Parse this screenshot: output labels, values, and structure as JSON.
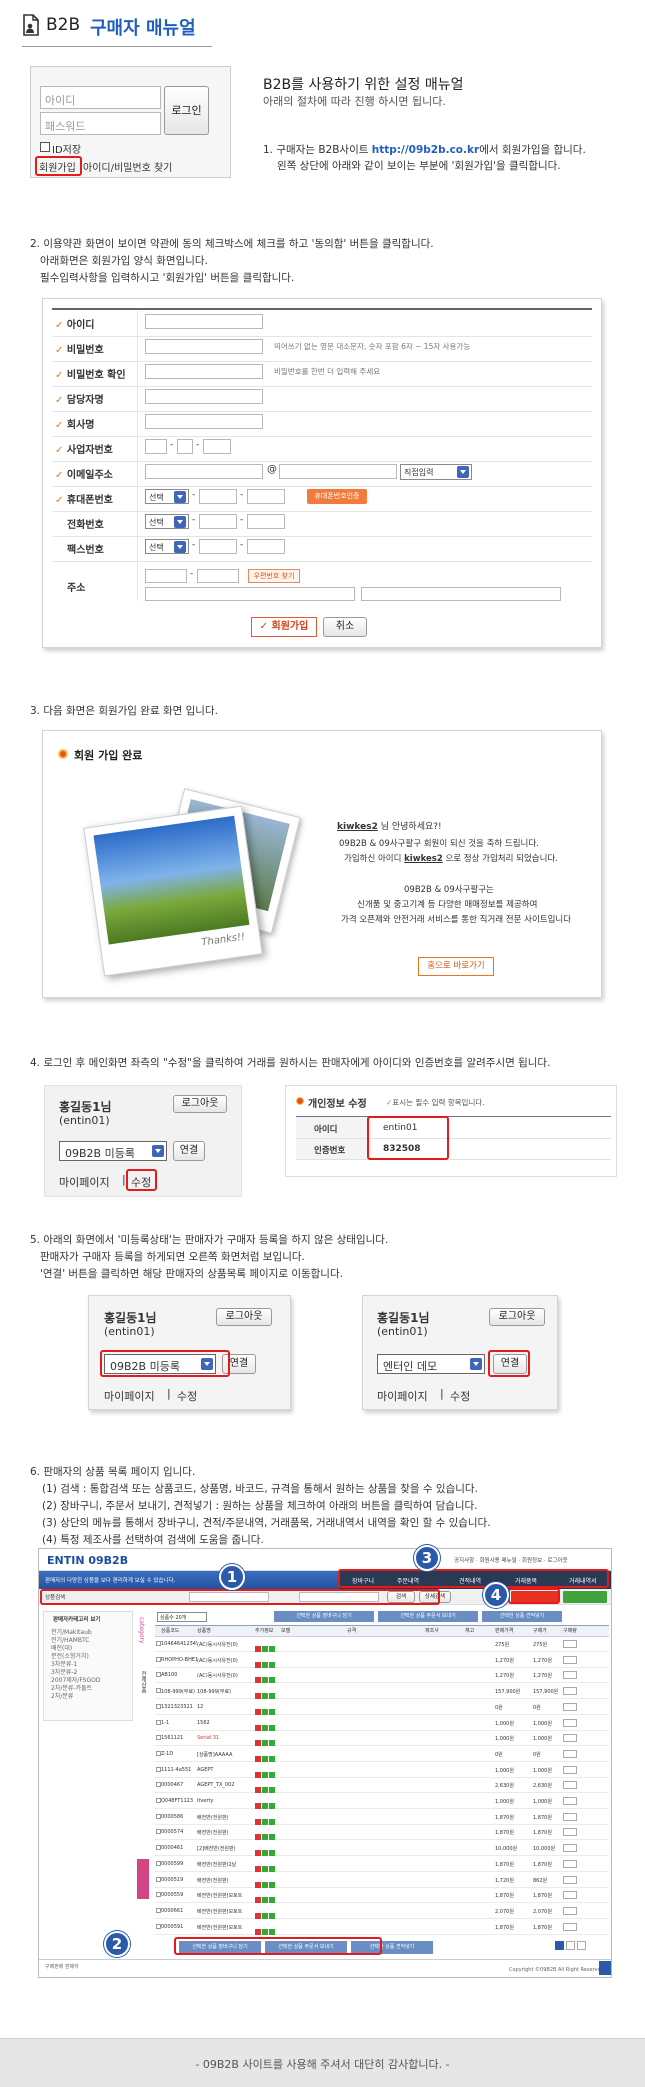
{
  "header": {
    "title_prefix": "B2B",
    "title_main": "구매자 매뉴얼"
  },
  "login_widget": {
    "id_placeholder": "아이디",
    "pw_placeholder": "패스워드",
    "login_btn": "로그인",
    "save_id": "ID저장",
    "join_link": "회원가입",
    "find_link": "아이디/비밀번호 찾기"
  },
  "intro": {
    "title": "B2B를 사용하기 위한 설정 매뉴얼",
    "subtitle": "아래의 절차에 따라 진행 하시면 됩니다.",
    "step1_a": "1. 구매자는 B2B사이트 ",
    "step1_link": "http://09b2b.co.kr",
    "step1_b": "에서 회원가입을 합니다.",
    "step1_c": "왼쪽 상단에 아래와 같이 보이는 부분에 '회원가입'을 클릭합니다."
  },
  "step2": {
    "line1": "2. 이용약관 화면이 보이면 약관에 동의 체크박스에 체크를 하고 '동의함' 버튼을 클릭합니다.",
    "line2": "아래화면은 회원가입 양식 화면입니다.",
    "line3": "필수입력사항을 입력하시고 '회원가입' 버튼을 클릭합니다."
  },
  "signup_form": {
    "labels": [
      "아이디",
      "비밀번호",
      "비밀번호 확인",
      "담당자명",
      "회사명",
      "사업자번호",
      "이메일주소",
      "휴대폰번호",
      "전화번호",
      "팩스번호",
      "주소"
    ],
    "pw_hint": "띄어쓰기 없는 영문 대소문자, 숫자 포함 6자 ~ 15자 사용가능",
    "pw_confirm_hint": "비밀번호를 한번 더 입력해 주세요",
    "email_at": "@",
    "email_select": "직접입력",
    "select_label": "선택",
    "phone_verify_btn": "휴대폰번호인증",
    "zip_btn": "우편번호 찾기",
    "submit_btn": "회원가입",
    "cancel_btn": "취소"
  },
  "step3": {
    "line1": "3. 다음 화면은 회원가입 완료 화면 입니다."
  },
  "complete": {
    "title": "회원 가입 완료",
    "user": "kiwkes2",
    "greet": " 님 안녕하세요?!",
    "msg1": "09B2B & 09사구팔구 회원이 되신 것을 축하 드립니다.",
    "msg2a": "가입하신 아이디 ",
    "msg2b": " 으로 정상 가입처리 되었습니다.",
    "msg3": "09B2B & 09사구팔구는",
    "msg4": "신개품 및 중고기계 등 다양한 매매정보를 제공하여",
    "msg5": "가격 오픈제와 안전거래 서비스를 통한 직거래 전문 사이트입니다",
    "home_btn": "홈으로 바로가기",
    "photo_caption": "Thanks!!"
  },
  "step4": {
    "line1": "4. 로그인 후 메인화면 좌측의 \"수정\"을 클릭하여 거래를 원하시는 판매자에게 아이디와 인증번호를 알려주시면 됩니다."
  },
  "user_widget": {
    "name": "홍길동1님",
    "id": "(entin01)",
    "logout": "로그아웃",
    "seller_unreg": "09B2B 미등록",
    "seller_demo": "엔터인 데모",
    "connect": "연결",
    "mypage": "마이페이지",
    "edit": "수정"
  },
  "profile": {
    "title": "개인정보 수정",
    "required": "표시는 필수 입력 항목입니다.",
    "id_label": "아이디",
    "id_value": "entin01",
    "cert_label": "인증번호",
    "cert_value": "832508"
  },
  "step5": {
    "line1": "5. 아래의 화면에서 '미등록상태'는 판매자가 구매자 등록을 하지 않은 상태입니다.",
    "line2": "판매자가 구매자 등록을 하게되면 오른쪽 화면처럼 보입니다.",
    "line3": "'연결' 버튼을 클릭하면 해당 판매자의 상품목록 페이지로 이동합니다."
  },
  "step6": {
    "line1": "6. 판매자의 상품 목록 페이지 입니다.",
    "line2": "(1) 검색 : 통합검색 또는 상품코드, 상품명, 바코드, 규격을 통해서 원하는 상품을 찾을 수 있습니다.",
    "line3": "(2) 장바구니, 주문서 보내기, 견적넣기 : 원하는 상품을 체크하여 아래의 버튼을 클릭하여 담습니다.",
    "line4": "(3) 상단의 메뉴를 통해서 장바구니, 견적/주문내역, 거래품목, 거래내역서 내역을 확인 할 수 있습니다.",
    "line5": "(4) 특정 제조사를 선택하여 검색에 도움을 줍니다."
  },
  "shop": {
    "logo": "ENTIN 09B2B",
    "top_links": [
      "공지사항",
      "회원사용 매뉴얼",
      "회원정보",
      "로그아웃"
    ],
    "menu": [
      "장바구니",
      "주문내역",
      "견적내역",
      "거래품목",
      "거래내역서"
    ],
    "welcome": "판매자의 다양한 상품을 보다 편리하게 보실 수 있습니다.",
    "search_label": "상품검색",
    "search_btn": "검색",
    "detail_btn": "상세검색",
    "category_title": "판매자카테고리 보기",
    "categories": [
      "전기/Makitaub",
      "전기/HAMBTC",
      "배전(대)",
      "분전(소형거치)",
      "3차분류-1",
      "3차분류-2",
      "2007제자/FSGOD",
      "2차/분류-카돌트",
      "2차/분류"
    ],
    "vertical_cat": "category",
    "vertical_lbl": "전체상품",
    "per_page": "상품수 20개",
    "col_headers": [
      "상품코드",
      "상품명",
      "추가정보",
      "모델",
      "규격",
      "제조사",
      "재고",
      "판매가격",
      "구매가",
      "구매량"
    ],
    "actions_top": [
      "선택한 상품 장바구니 담기",
      "선택한 상품 주문서 보내기",
      "선택한 상품 견적넣기"
    ],
    "rows": [
      [
        "10464641234567890",
        "(AC)동시사유전(0)",
        "",
        "",
        "",
        "",
        "",
        "275원",
        "275원",
        ""
      ],
      [
        "RHOPHO-BHE12",
        "(AC)동시사유전(0)",
        "",
        "",
        "",
        "",
        "",
        "1,270원",
        "1,270원",
        ""
      ],
      [
        "AB100",
        "(AC)동시사유전(0)",
        "",
        "",
        "",
        "",
        "",
        "1,270원",
        "1,270원",
        ""
      ],
      [
        "108-999(무료)",
        "108-999(무료)",
        "",
        "",
        "",
        "",
        "",
        "157,900원",
        "157,900원",
        ""
      ],
      [
        "1321323321",
        "12",
        "",
        "",
        "",
        "",
        "",
        "0원",
        "0원",
        ""
      ],
      [
        "1-1",
        "1562",
        "",
        "",
        "",
        "",
        "",
        "1,000원",
        "1,000원",
        ""
      ],
      [
        "1561121",
        "Serial 31",
        "",
        "",
        "",
        "",
        "",
        "1,000원",
        "1,000원",
        ""
      ],
      [
        "Z-1D",
        "[상품명]AAAAA",
        "",
        "",
        "",
        "",
        "",
        "0원",
        "0원",
        ""
      ],
      [
        "1111-4a551",
        "AGEPT",
        "",
        "",
        "",
        "",
        "",
        "1,000원",
        "1,000원",
        ""
      ],
      [
        "0000467",
        "AGEPT_TX_002",
        "",
        "",
        "",
        "",
        "",
        "2,630원",
        "2,630원",
        ""
      ],
      [
        "Q048FT1123",
        "Itverty",
        "",
        "",
        "",
        "",
        "",
        "1,000원",
        "1,000원",
        ""
      ],
      [
        "0000586",
        "배전반(전원판)",
        "",
        "",
        "",
        "",
        "",
        "1,870원",
        "1,870원",
        ""
      ],
      [
        "0000574",
        "배전반(전원판)",
        "",
        "",
        "",
        "",
        "",
        "1,870원",
        "1,870원",
        ""
      ],
      [
        "0000461",
        "[2]배전반(전원판)",
        "",
        "",
        "",
        "",
        "",
        "10,000원",
        "10,000원",
        ""
      ],
      [
        "0000599",
        "배전반(전원판)2날",
        "",
        "",
        "",
        "",
        "",
        "1,870원",
        "1,870원",
        ""
      ],
      [
        "0000519",
        "배전반(전원판)",
        "",
        "",
        "",
        "",
        "",
        "1,720원",
        "862원",
        ""
      ],
      [
        "0000559",
        "배전반(전원판)모토트",
        "",
        "",
        "",
        "",
        "",
        "1,870원",
        "1,870원",
        ""
      ],
      [
        "0000661",
        "배전반(전원판)모토트",
        "",
        "",
        "",
        "",
        "",
        "2,070원",
        "2,070원",
        ""
      ],
      [
        "0000591",
        "배전반(전원판)모토트",
        "",
        "",
        "",
        "",
        "",
        "1,870원",
        "1,870원",
        ""
      ]
    ],
    "footer_company": "구매판매 판매자",
    "footer_copy": "Copyright ©09B2B All Right Reserved."
  },
  "callouts": {
    "n1": "1",
    "n2": "2",
    "n3": "3",
    "n4": "4"
  },
  "footer": {
    "text": "- 09B2B 사이트를 사용해 주셔서 대단히 감사합니다. -"
  },
  "colors": {
    "accent_blue": "#1f5fbf",
    "red_box": "#e31b1b",
    "orange_check": "#e8741f"
  }
}
